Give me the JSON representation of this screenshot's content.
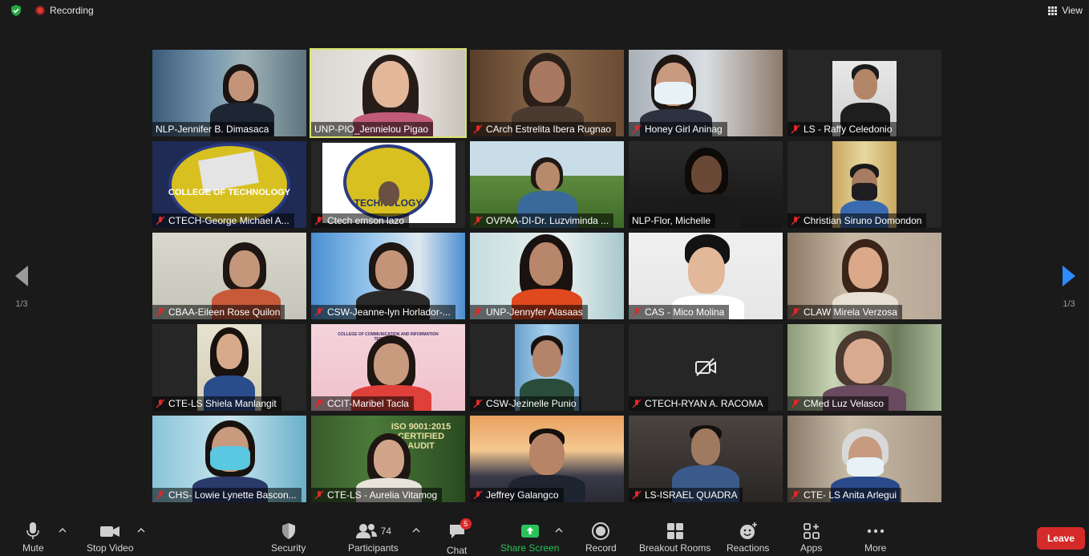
{
  "topbar": {
    "recording_label": "Recording",
    "view_label": "View"
  },
  "navigation": {
    "page_left": "1/3",
    "page_right": "1/3"
  },
  "participants_grid": [
    {
      "name": "NLP-Jennifer B. Dimasaca",
      "muted": false,
      "active": false
    },
    {
      "name": "UNP-PIO_Jennielou Pigao",
      "muted": false,
      "active": true
    },
    {
      "name": "CArch Estrelita Ibera Rugnao",
      "muted": true,
      "active": false
    },
    {
      "name": "Honey Girl Aninag",
      "muted": true,
      "active": false
    },
    {
      "name": "LS - Raffy Celedonio",
      "muted": true,
      "active": false
    },
    {
      "name": "CTECH-George Michael A...",
      "muted": true,
      "active": false
    },
    {
      "name": "Ctech emson lazo",
      "muted": true,
      "active": false
    },
    {
      "name": "OVPAA-DI-Dr. Luzviminda ...",
      "muted": true,
      "active": false
    },
    {
      "name": "NLP-Flor, Michelle",
      "muted": false,
      "active": false
    },
    {
      "name": "Christian Siruno Domondon",
      "muted": true,
      "active": false
    },
    {
      "name": "CBAA-Eileen Rose Quilon",
      "muted": true,
      "active": false
    },
    {
      "name": "CSW-Jeanne-lyn Horlador-...",
      "muted": true,
      "active": false
    },
    {
      "name": "UNP-Jennyfer Alasaas",
      "muted": true,
      "active": false
    },
    {
      "name": "CAS - Mico Molina",
      "muted": true,
      "active": false
    },
    {
      "name": "CLAW Mirela Verzosa",
      "muted": true,
      "active": false
    },
    {
      "name": "CTE-LS Shiela Manlangit",
      "muted": true,
      "active": false
    },
    {
      "name": "CCIT-Maribel Tacla",
      "muted": true,
      "active": false
    },
    {
      "name": "CSW-Jezinelle Punio",
      "muted": true,
      "active": false
    },
    {
      "name": "CTECH-RYAN A. RACOMA",
      "muted": true,
      "active": false
    },
    {
      "name": "CMed Luz Velasco",
      "muted": true,
      "active": false
    },
    {
      "name": "CHS- Lowie Lynette Bascon...",
      "muted": true,
      "active": false
    },
    {
      "name": "CTE-LS - Aurelia Vitamog",
      "muted": true,
      "active": false
    },
    {
      "name": "Jeffrey Galangco",
      "muted": true,
      "active": false
    },
    {
      "name": "LS-ISRAEL QUADRA",
      "muted": true,
      "active": false
    },
    {
      "name": "CTE- LS  Anita Arlegui",
      "muted": true,
      "active": false
    }
  ],
  "tile_texts": {
    "cot_logo_1": "COLLEGE OF TECHNOLOGY",
    "cot_logo_2": "TECHNOLOGY",
    "ccit_banner": "COLLEGE OF COMMUNICATION AND INFORMATION TECHNOLOGY",
    "iso_banner": "ISO 9001:2015 CERTIFIED AUDIT"
  },
  "toolbar": {
    "mute": "Mute",
    "stop_video": "Stop Video",
    "security": "Security",
    "participants": "Participants",
    "participants_count": "74",
    "chat": "Chat",
    "chat_badge": "5",
    "share_screen": "Share Screen",
    "record": "Record",
    "breakout_rooms": "Breakout Rooms",
    "reactions": "Reactions",
    "apps": "Apps",
    "more": "More",
    "leave": "Leave"
  },
  "colors": {
    "accent_active_speaker": "#d9e36c",
    "share_green": "#2ac35a",
    "leave_red": "#d42a2a",
    "nav_arrow_blue": "#2d8cff"
  }
}
